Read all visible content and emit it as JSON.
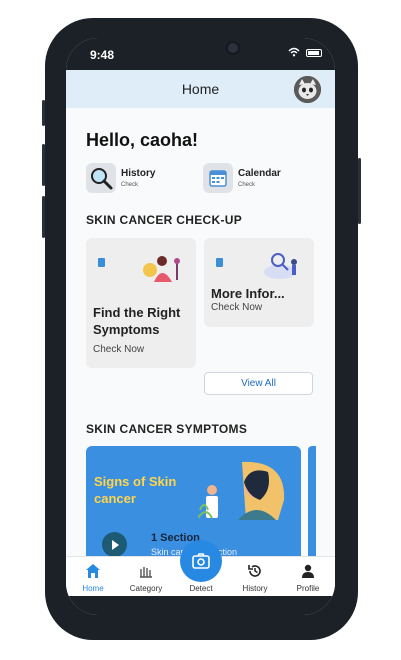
{
  "status": {
    "time": "9:48"
  },
  "appbar": {
    "title": "Home"
  },
  "greeting": "Hello, caoha!",
  "quick_actions": [
    {
      "label": "History",
      "sub": "Check",
      "icon": "magnifier-icon"
    },
    {
      "label": "Calendar",
      "sub": "Check",
      "icon": "calendar-icon"
    }
  ],
  "checkup": {
    "title": "SKIN CANCER CHECK-UP",
    "cards": [
      {
        "heading": "Find the Right Symptoms",
        "action": "Check Now"
      },
      {
        "heading": "More Infor...",
        "action": "Check Now"
      }
    ],
    "view_all": "View All"
  },
  "symptoms": {
    "title": "SKIN CANCER SYMPTOMS",
    "promo": {
      "title": "Signs of Skin cancer",
      "sections": "1 Section",
      "subtitle": "Skin cancer detection"
    }
  },
  "tabs": [
    {
      "label": "Home",
      "icon": "home-icon",
      "active": true
    },
    {
      "label": "Category",
      "icon": "category-icon",
      "active": false
    },
    {
      "label": "Detect",
      "icon": "camera-icon",
      "active": false
    },
    {
      "label": "History",
      "icon": "history-icon",
      "active": false
    },
    {
      "label": "Profile",
      "icon": "person-icon",
      "active": false
    }
  ],
  "colors": {
    "accent": "#2889e3",
    "promo": "#3a8fe0",
    "promo_title": "#ffd54a",
    "appbar": "#deedf8"
  }
}
